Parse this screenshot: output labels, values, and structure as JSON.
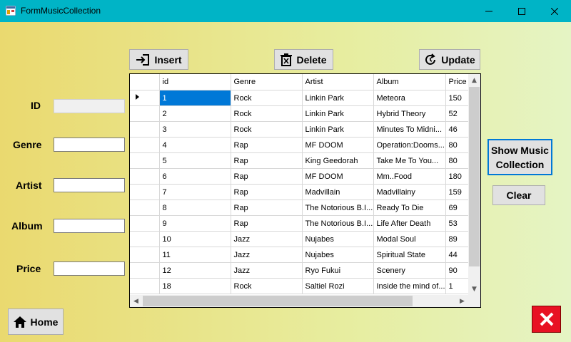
{
  "window": {
    "title": "FormMusicCollection"
  },
  "labels": {
    "id": "ID",
    "genre": "Genre",
    "artist": "Artist",
    "album": "Album",
    "price": "Price"
  },
  "fields": {
    "id": "",
    "genre": "",
    "artist": "",
    "album": "",
    "price": ""
  },
  "buttons": {
    "insert": "Insert",
    "delete": "Delete",
    "update": "Update",
    "show_music_line1": "Show Music",
    "show_music_line2": "Collection",
    "clear": "Clear",
    "home": "Home"
  },
  "grid": {
    "columns": [
      "id",
      "Genre",
      "Artist",
      "Album",
      "Price"
    ],
    "rows": [
      [
        "1",
        "Rock",
        "Linkin Park",
        "Meteora",
        "150"
      ],
      [
        "2",
        "Rock",
        "Linkin Park",
        "Hybrid Theory",
        "52"
      ],
      [
        "3",
        "Rock",
        "Linkin Park",
        "Minutes To Midni...",
        "46"
      ],
      [
        "4",
        "Rap",
        "MF DOOM",
        "Operation:Dooms...",
        "80"
      ],
      [
        "5",
        "Rap",
        "King Geedorah",
        "Take Me To You...",
        "80"
      ],
      [
        "6",
        "Rap",
        "MF DOOM",
        "Mm..Food",
        "180"
      ],
      [
        "7",
        "Rap",
        "Madvillain",
        "Madvillainy",
        "159"
      ],
      [
        "8",
        "Rap",
        "The Notorious B.I...",
        "Ready To Die",
        "69"
      ],
      [
        "9",
        "Rap",
        "The Notorious B.I...",
        "Life After Death",
        "53"
      ],
      [
        "10",
        "Jazz",
        "Nujabes",
        "Modal Soul",
        "89"
      ],
      [
        "11",
        "Jazz",
        "Nujabes",
        "Spiritual State",
        "44"
      ],
      [
        "12",
        "Jazz",
        "Ryo Fukui",
        "Scenery",
        "90"
      ],
      [
        "18",
        "Rock",
        "Saltiel Rozi",
        "Inside the mind of...",
        "1"
      ]
    ],
    "selected_row": 0
  },
  "colors": {
    "titlebar": "#00b4c6",
    "selection": "#0078d7",
    "close_red": "#e81123"
  }
}
